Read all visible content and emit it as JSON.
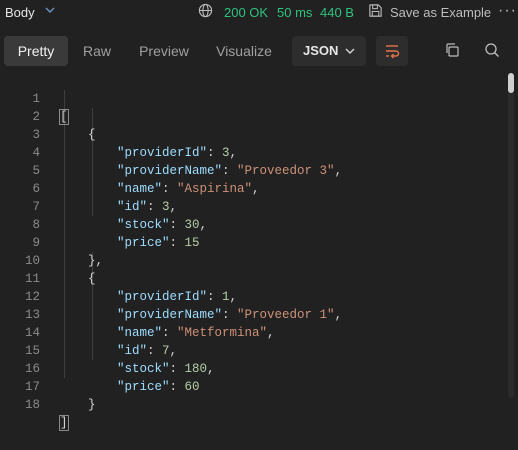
{
  "topbar": {
    "body_label": "Body",
    "status": "200 OK",
    "time": "50 ms",
    "size": "440 B",
    "save_label": "Save as Example",
    "more": "···"
  },
  "toolbar": {
    "tabs": [
      "Pretty",
      "Raw",
      "Preview",
      "Visualize"
    ],
    "active_tab": "Pretty",
    "format": "JSON"
  },
  "editor": {
    "line_numbers": [
      "1",
      "2",
      "3",
      "4",
      "5",
      "6",
      "7",
      "8",
      "9",
      "10",
      "11",
      "12",
      "13",
      "14",
      "15",
      "16",
      "17",
      "18"
    ],
    "records": [
      {
        "providerId": "3",
        "providerName": "\"Proveedor 3\"",
        "name": "\"Aspirina\"",
        "id": "3",
        "stock": "30",
        "price": "15"
      },
      {
        "providerId": "1",
        "providerName": "\"Proveedor 1\"",
        "name": "\"Metformina\"",
        "id": "7",
        "stock": "180",
        "price": "60"
      }
    ],
    "keys": {
      "providerId": "\"providerId\"",
      "providerName": "\"providerName\"",
      "name": "\"name\"",
      "id": "\"id\"",
      "stock": "\"stock\"",
      "price": "\"price\""
    },
    "punct": {
      "open_array": "[",
      "close_array": "]",
      "open_obj": "{",
      "close_obj_comma": "},",
      "close_obj": "}",
      "colon": ": ",
      "comma": ","
    }
  },
  "colors": {
    "status_ok": "#2ec27e",
    "key": "#9cdcfe",
    "string": "#ce9178",
    "number": "#b5cea8",
    "wrap_icon": "#e8734a"
  },
  "icons": [
    "chevron-down-icon",
    "globe-icon",
    "save-icon",
    "more-icon",
    "chevron-down-icon",
    "wrap-lines-icon",
    "copy-icon",
    "search-icon"
  ]
}
